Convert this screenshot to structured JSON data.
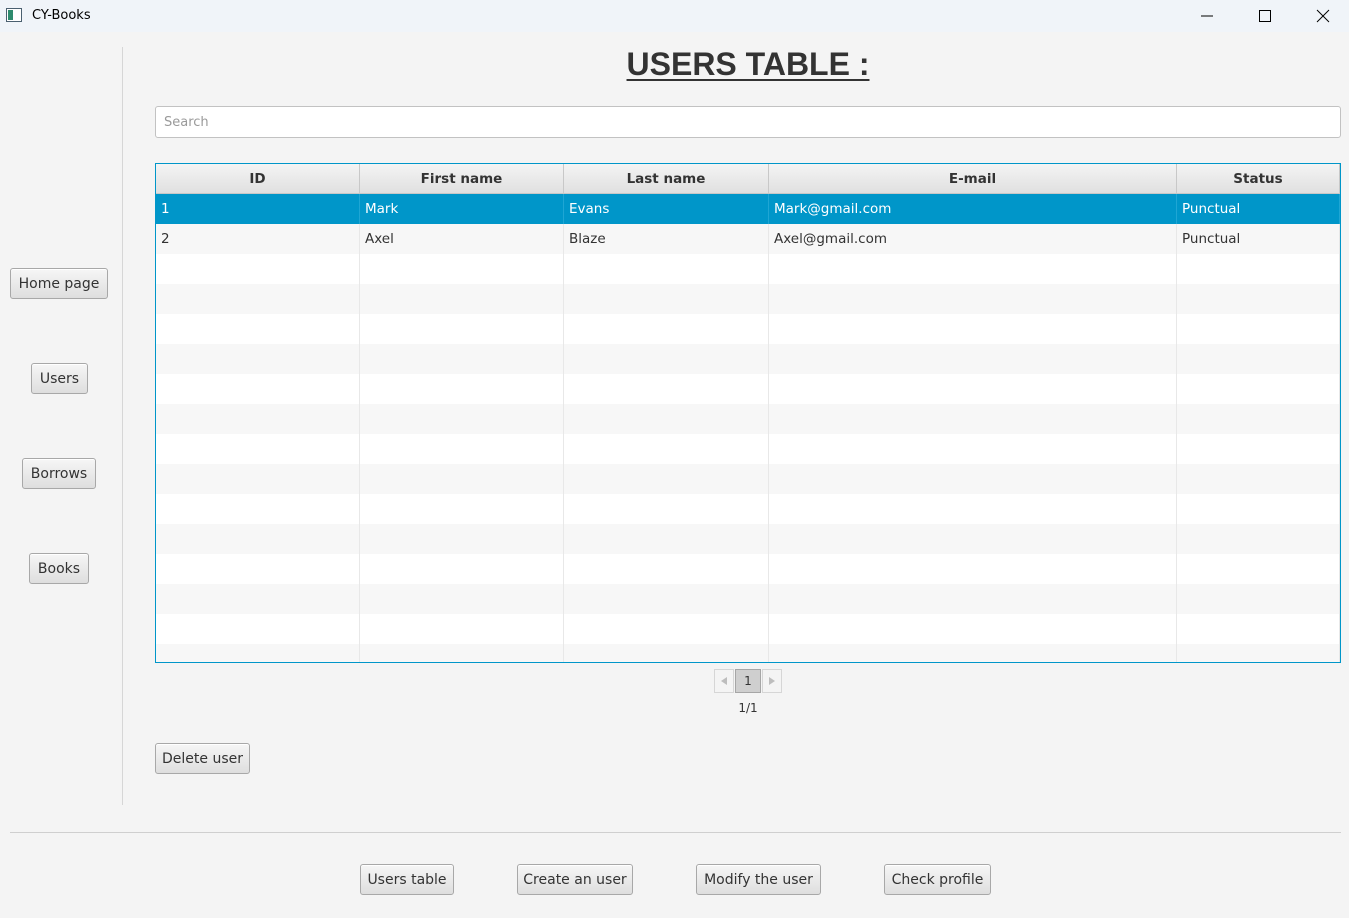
{
  "window": {
    "title": "CY-Books"
  },
  "sidebar": {
    "items": [
      {
        "label": "Home page"
      },
      {
        "label": "Users"
      },
      {
        "label": "Borrows"
      },
      {
        "label": "Books"
      }
    ]
  },
  "main": {
    "title": "USERS TABLE :",
    "search": {
      "placeholder": "Search",
      "value": ""
    },
    "table": {
      "columns": [
        "ID",
        "First name",
        "Last name",
        "E-mail",
        "Status"
      ],
      "rows": [
        [
          "1",
          "Mark",
          "Evans",
          "Mark@gmail.com",
          "Punctual"
        ],
        [
          "2",
          "Axel",
          "Blaze",
          "Axel@gmail.com",
          "Punctual"
        ]
      ],
      "selected_row": 0
    },
    "pagination": {
      "current_page": "1",
      "label": "1/1"
    },
    "delete_label": "Delete user"
  },
  "footer": {
    "users_table_label": "Users table",
    "create_label": "Create an user",
    "modify_label": "Modify the user",
    "profile_label": "Check profile"
  },
  "colors": {
    "accent": "#0096c9",
    "background": "#f4f4f4",
    "titlebar": "#f0f4f9"
  }
}
